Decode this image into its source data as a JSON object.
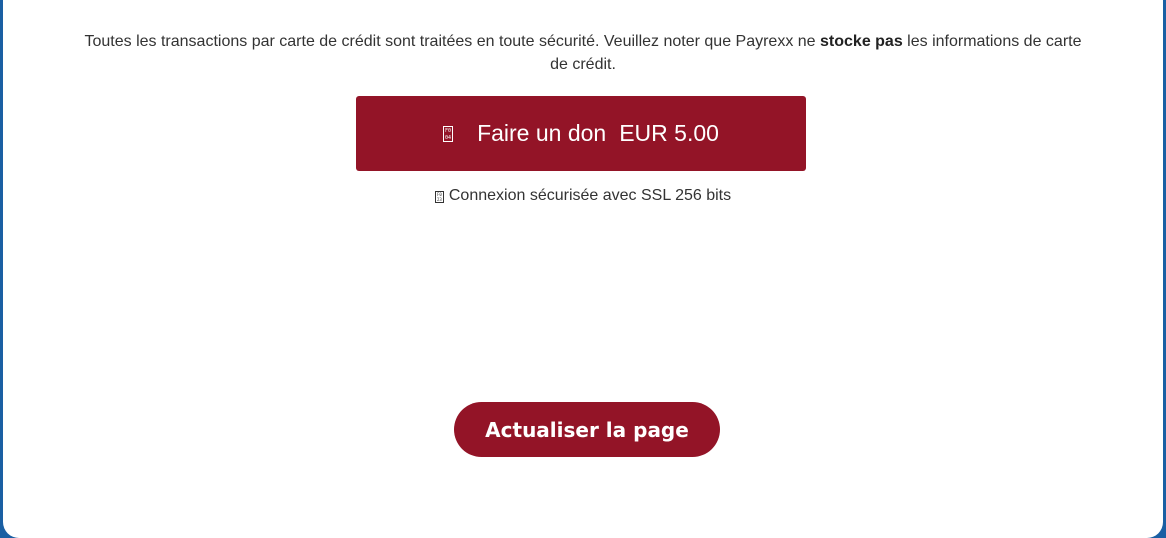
{
  "notice": {
    "text_before": "Toutes les transactions par carte de crédit sont traitées en toute sécurité. Veuillez noter que Payrexx ne ",
    "bold": "stocke pas",
    "text_after": " les informations de carte de crédit."
  },
  "pay_button": {
    "icon": "lock-icon",
    "label": "Faire un don",
    "amount": "EUR 5.00"
  },
  "ssl": {
    "icon": "lock-icon",
    "text": "Connexion sécurisée avec SSL 256 bits"
  },
  "refresh_button": {
    "label": "Actualiser la page"
  },
  "colors": {
    "accent": "#931427",
    "frame": "#1a5fa3"
  }
}
